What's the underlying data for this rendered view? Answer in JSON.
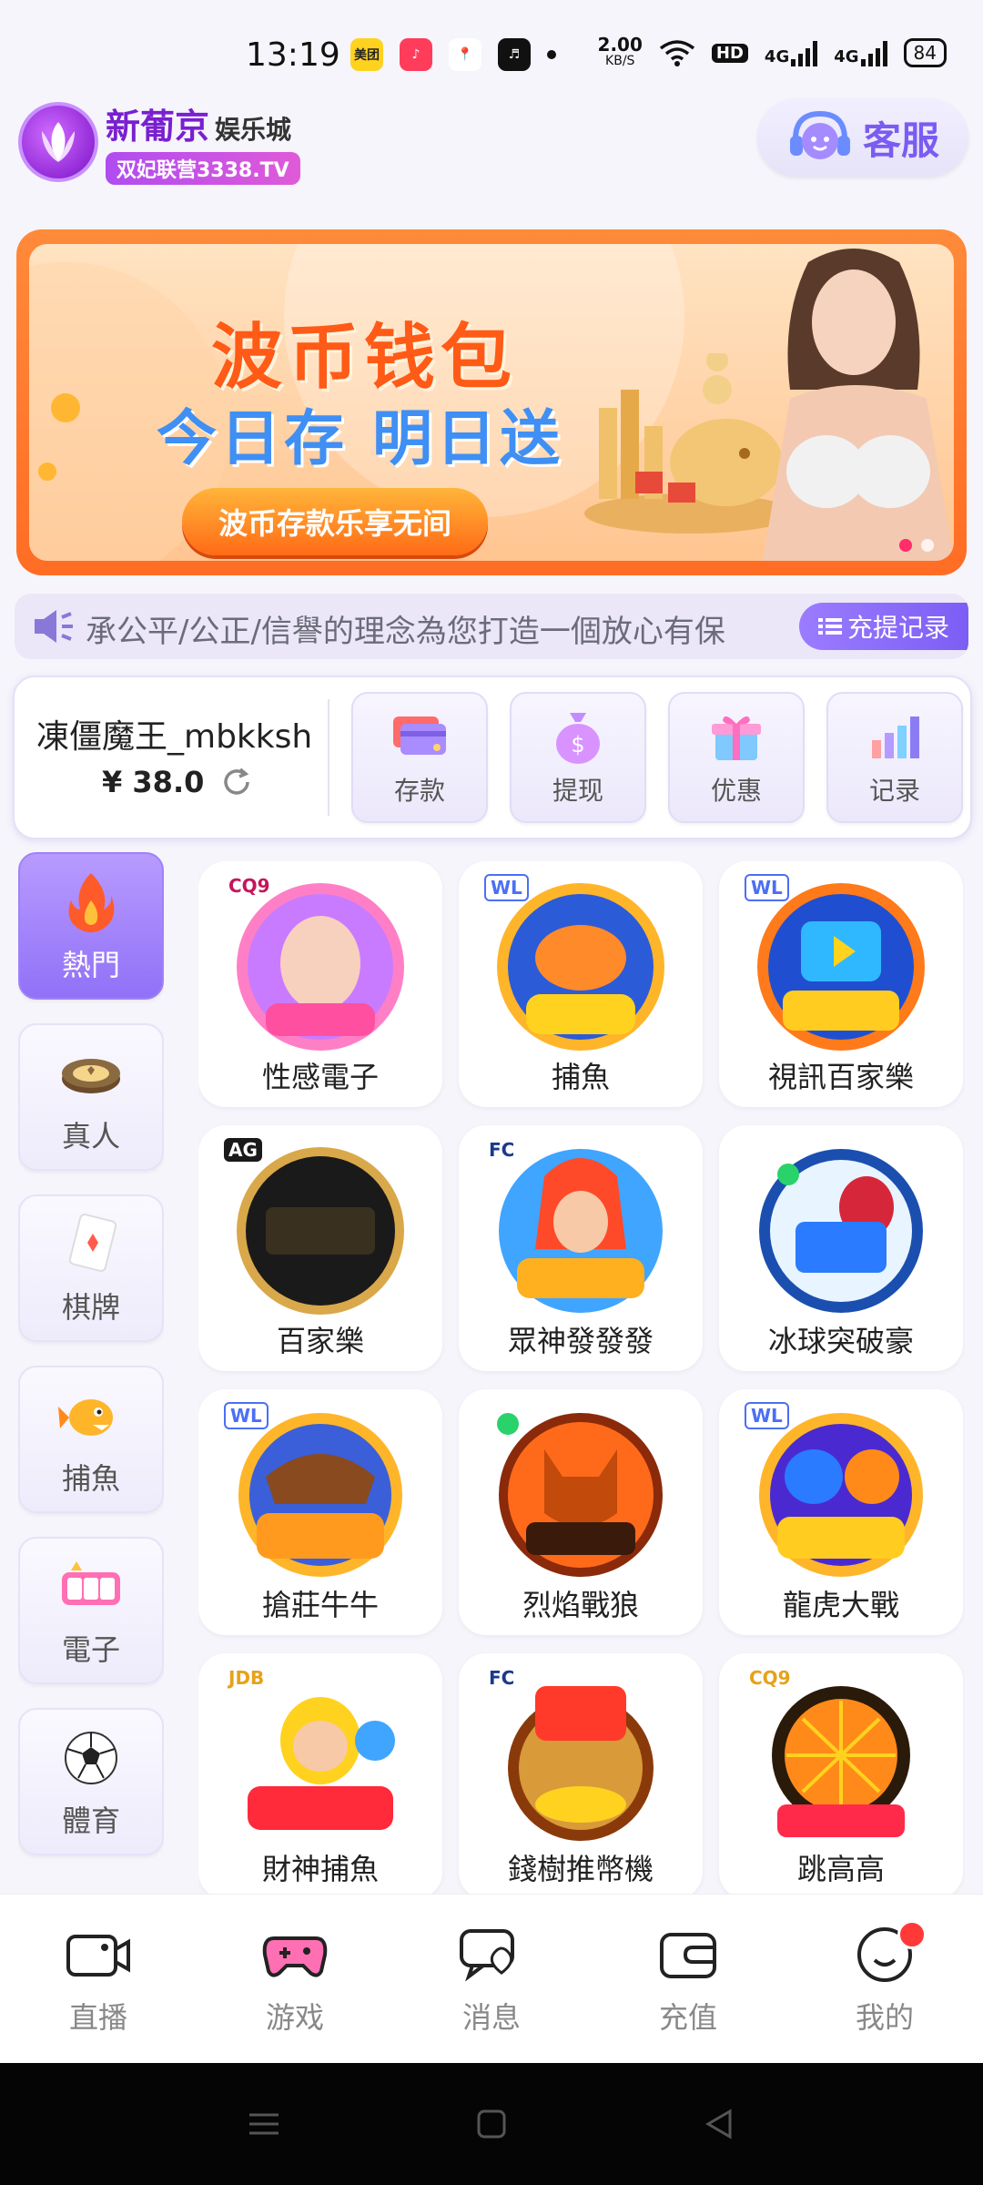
{
  "status_bar": {
    "time": "13:19",
    "app_icons": [
      "美团",
      "♪",
      "📍",
      "♬"
    ],
    "net_speed_value": "2.00",
    "net_speed_unit": "KB/S",
    "hd_label": "HD",
    "net1": "4G",
    "net2": "4G",
    "battery": "84"
  },
  "header": {
    "logo_title": "新葡京",
    "logo_suffix": "娱乐城",
    "logo_sub": "双妃联营3338.TV",
    "service_label": "客服"
  },
  "banner": {
    "title": "波币钱包",
    "subtitle": "今日存 明日送",
    "button": "波币存款乐享无间",
    "active_slide": 1,
    "slide_count": 2
  },
  "marquee": {
    "text": "承公平/公正/信譽的理念為您打造一個放心有保",
    "records_label": "充提记录"
  },
  "account": {
    "username": "凍僵魔王_mbkksh",
    "balance": "¥ 38.0",
    "actions": [
      {
        "label": "存款",
        "icon": "card-icon"
      },
      {
        "label": "提现",
        "icon": "money-bag-icon"
      },
      {
        "label": "优惠",
        "icon": "gift-icon"
      },
      {
        "label": "记录",
        "icon": "bar-chart-icon"
      }
    ]
  },
  "categories": [
    {
      "label": "熱門",
      "icon": "fire-icon",
      "active": true
    },
    {
      "label": "真人",
      "icon": "chip-icon",
      "active": false
    },
    {
      "label": "棋牌",
      "icon": "playing-card-icon",
      "active": false
    },
    {
      "label": "捕魚",
      "icon": "fish-icon",
      "active": false
    },
    {
      "label": "電子",
      "icon": "slot-icon",
      "active": false
    },
    {
      "label": "體育",
      "icon": "soccer-ball-icon",
      "active": false
    }
  ],
  "games": [
    {
      "label": "性感電子",
      "brand": "CQ9"
    },
    {
      "label": "捕魚",
      "brand": "WL"
    },
    {
      "label": "視訊百家樂",
      "brand": "WL"
    },
    {
      "label": "百家樂",
      "brand": "AG"
    },
    {
      "label": "眾神發發發",
      "brand": "FC"
    },
    {
      "label": "冰球突破豪",
      "brand": ""
    },
    {
      "label": "搶莊牛牛",
      "brand": "WL"
    },
    {
      "label": "烈焰戰狼",
      "brand": ""
    },
    {
      "label": "龍虎大戰",
      "brand": "WL"
    },
    {
      "label": "財神捕魚",
      "brand": "JDB"
    },
    {
      "label": "錢樹推幣機",
      "brand": "FC"
    },
    {
      "label": "跳高高",
      "brand": "CQ9"
    }
  ],
  "tabs": [
    {
      "label": "直播",
      "icon": "camera-icon"
    },
    {
      "label": "游戏",
      "icon": "gamepad-icon"
    },
    {
      "label": "消息",
      "icon": "chat-icon"
    },
    {
      "label": "充值",
      "icon": "wallet-icon"
    },
    {
      "label": "我的",
      "icon": "profile-icon"
    }
  ],
  "colors": {
    "accent": "#8b6bf6",
    "banner_orange": "#ff6d24",
    "badge_red": "#ff3838"
  }
}
